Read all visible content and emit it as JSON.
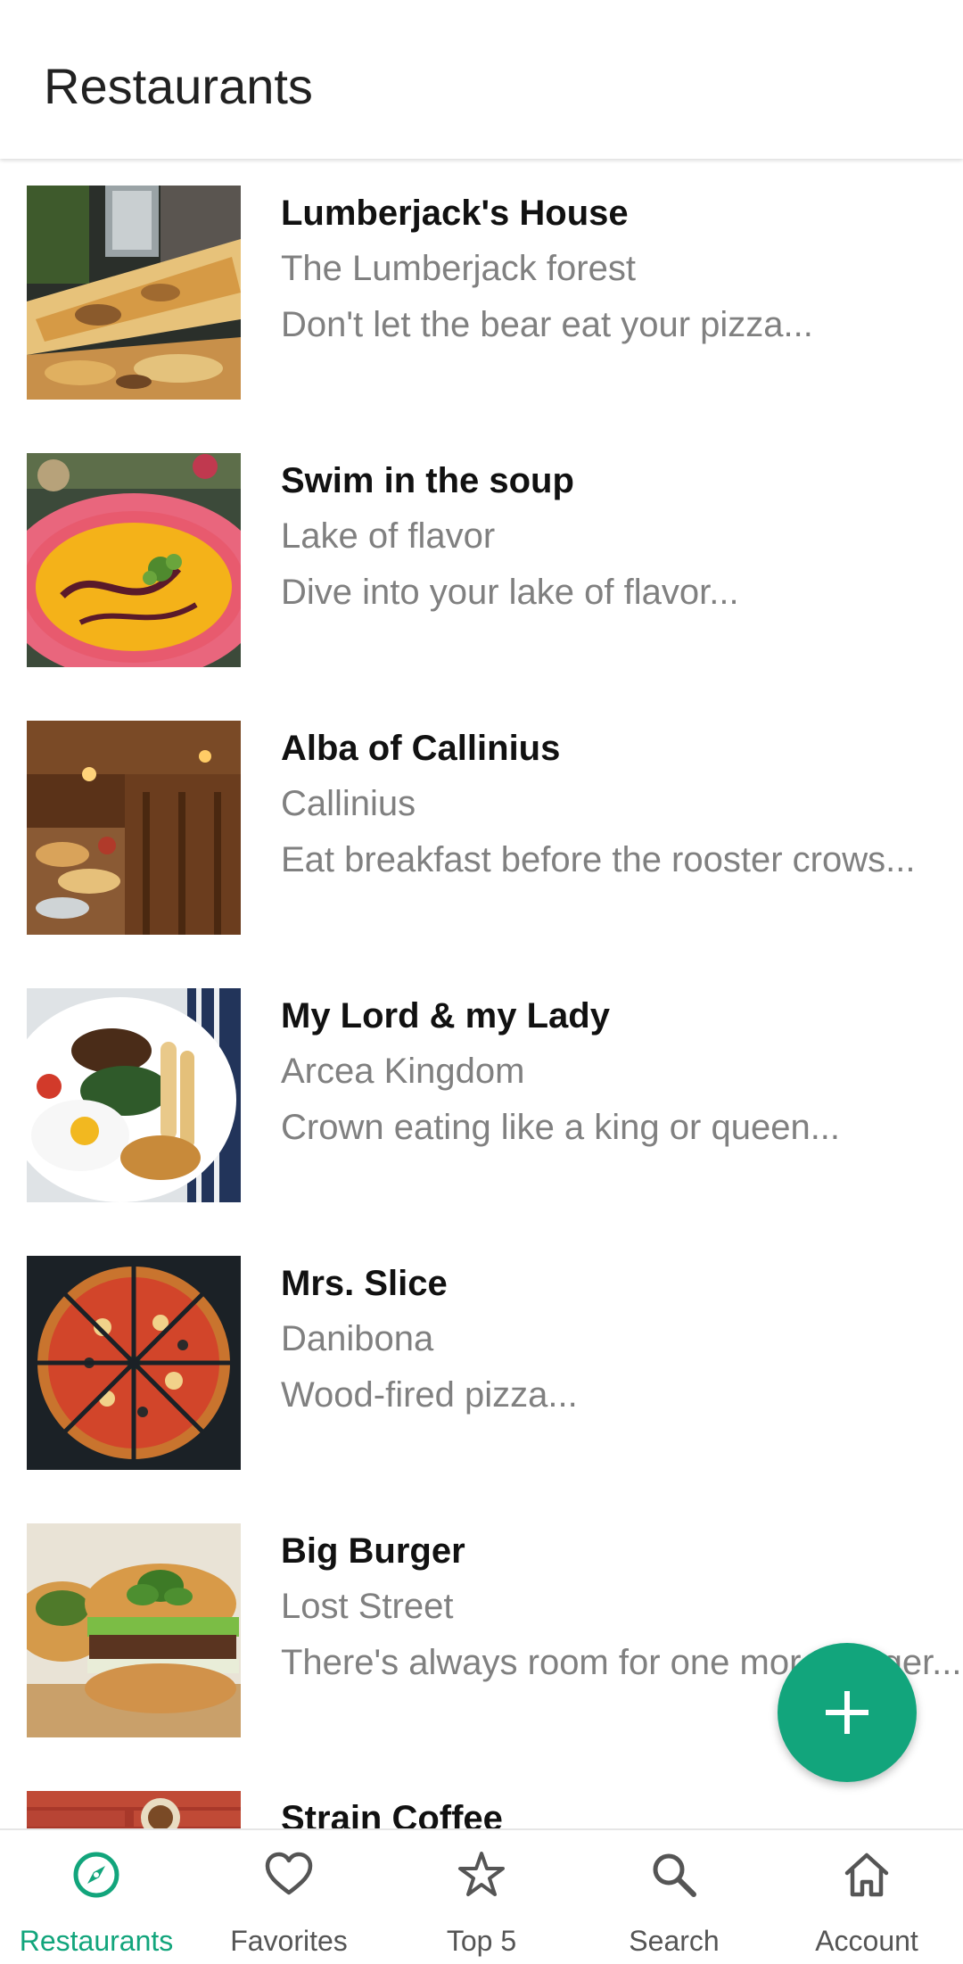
{
  "app_bar": {
    "title": "Restaurants"
  },
  "restaurants": [
    {
      "name": "Lumberjack's House",
      "location": "The Lumberjack forest",
      "description": "Don't let the bear eat your pizza...",
      "image": "pizza-slice-photo"
    },
    {
      "name": "Swim in the soup",
      "location": "Lake of flavor",
      "description": "Dive into your lake of flavor...",
      "image": "soup-bowl-photo"
    },
    {
      "name": "Alba of Callinius",
      "location": "Callinius",
      "description": "Eat breakfast before the rooster crows...",
      "image": "breakfast-buffet-photo"
    },
    {
      "name": "My Lord & my Lady",
      "location": "Arcea Kingdom",
      "description": "Crown eating like a king or queen...",
      "image": "breakfast-plate-photo"
    },
    {
      "name": "Mrs. Slice",
      "location": "Danibona",
      "description": "Wood-fired pizza...",
      "image": "sliced-pizza-photo"
    },
    {
      "name": "Big Burger",
      "location": "Lost Street",
      "description": "There's always room for one more burger...",
      "image": "burger-photo"
    },
    {
      "name": "Strain Coffee",
      "location": "",
      "description": "",
      "image": "coffee-photo"
    }
  ],
  "fab": {
    "icon": "plus-icon"
  },
  "bottom_nav": {
    "items": [
      {
        "label": "Restaurants",
        "icon": "compass-icon",
        "active": true
      },
      {
        "label": "Favorites",
        "icon": "heart-icon",
        "active": false
      },
      {
        "label": "Top 5",
        "icon": "star-icon",
        "active": false
      },
      {
        "label": "Search",
        "icon": "search-icon",
        "active": false
      },
      {
        "label": "Account",
        "icon": "home-icon",
        "active": false
      }
    ]
  },
  "colors": {
    "accent": "#12a57c",
    "title_text": "#212121",
    "secondary_text": "#808080",
    "nav_inactive": "#555555"
  }
}
